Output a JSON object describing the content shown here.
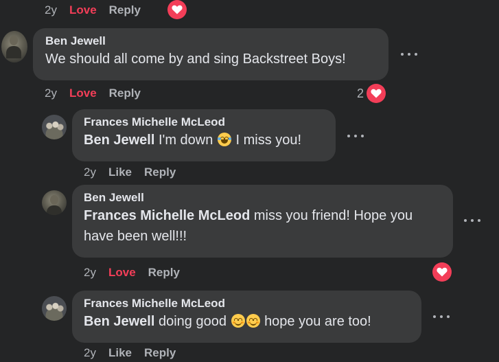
{
  "top_actions": {
    "time": "2y",
    "reaction": "Love",
    "reply": "Reply"
  },
  "comments": [
    {
      "author": "Ben Jewell",
      "mention": "",
      "text": "We should all come by and sing Backstreet Boys!",
      "time": "2y",
      "reaction": "Love",
      "reply": "Reply",
      "reaction_count": "2"
    },
    {
      "author": "Frances Michelle McLeod",
      "mention": "Ben Jewell",
      "text_before_emoji": "I'm down",
      "text_after_emoji": "I miss you!",
      "time": "2y",
      "reaction": "Like",
      "reply": "Reply"
    },
    {
      "author": "Ben Jewell",
      "mention": "Frances Michelle McLeod",
      "text": "miss you friend! Hope you have been well!!!",
      "time": "2y",
      "reaction": "Love",
      "reply": "Reply"
    },
    {
      "author": "Frances Michelle McLeod",
      "mention": "Ben Jewell",
      "text_before_emoji": "doing good",
      "text_after_emoji": "hope you are too!",
      "time": "2y",
      "reaction": "Like",
      "reply": "Reply"
    }
  ],
  "colors": {
    "background": "#242526",
    "bubble": "#3a3b3c",
    "love_red": "#f33e58",
    "secondary_text": "#b0b3b8"
  },
  "icons": [
    "heart-icon",
    "more-options-icon",
    "laughing-face-icon",
    "smiling-face-icon"
  ]
}
